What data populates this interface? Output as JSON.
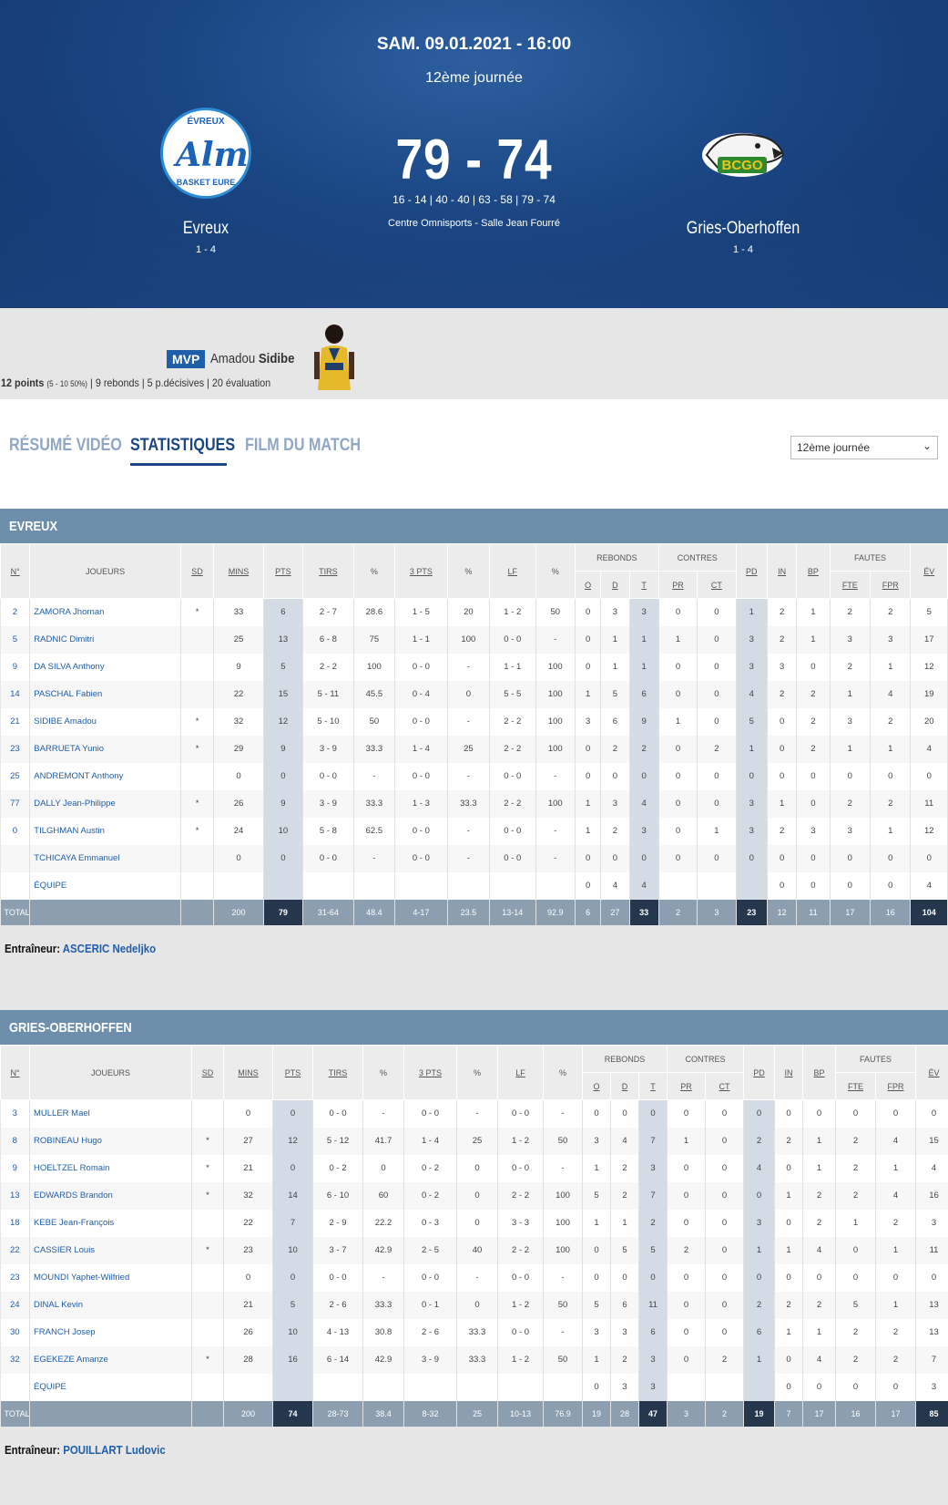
{
  "match": {
    "date": "SAM. 09.01.2021 - 16:00",
    "round": "12ème journée",
    "score": "79 - 74",
    "periods": "16 - 14 | 40 - 40 | 63 - 58 | 79 - 74",
    "venue": "Centre Omnisports - Salle Jean Fourré",
    "home": {
      "name": "Evreux",
      "record": "1 - 4",
      "logo_top": "ÉVREUX",
      "logo_main": "Alm",
      "logo_bottom": "BASKET EURE"
    },
    "away": {
      "name": "Gries-Oberhoffen",
      "record": "1 - 4",
      "logo_text": "BCGO"
    }
  },
  "mvp": {
    "tag": "MVP",
    "first_name": "Amadou",
    "last_name": "Sidibe",
    "points": "12 points",
    "shooting": "(5 - 10 50%)",
    "rest": "| 9 rebonds | 5 p.décisives | 20 évaluation"
  },
  "tabs": [
    "RÉSUMÉ VIDÉO",
    "STATISTIQUES",
    "FILM DU MATCH"
  ],
  "round_select": "12ème journée",
  "headers": {
    "num": "N°",
    "player": "JOUEURS",
    "sd": "SD",
    "mins": "MINS",
    "pts": "PTS",
    "tirs": "TIRS",
    "pct": "%",
    "three": "3 PTS",
    "lf": "LF",
    "rebonds": "REBONDS",
    "o": "O",
    "d": "D",
    "t": "T",
    "contres": "CONTRES",
    "pr": "PR",
    "ct": "CT",
    "pd": "PD",
    "in": "IN",
    "bp": "BP",
    "fautes": "FAUTES",
    "fte": "FTE",
    "fpr": "FPR",
    "ev": "ÉV"
  },
  "teams": [
    {
      "title": "EVREUX",
      "coach_label": "Entraîneur:",
      "coach": "ASCERIC Nedeljko",
      "players": [
        [
          "2",
          "ZAMORA Jhornan",
          "*",
          "33",
          "6",
          "2 - 7",
          "28.6",
          "1 - 5",
          "20",
          "1 - 2",
          "50",
          "0",
          "3",
          "3",
          "0",
          "0",
          "1",
          "2",
          "1",
          "2",
          "2",
          "5"
        ],
        [
          "5",
          "RADNIC Dimitri",
          "",
          "25",
          "13",
          "6 - 8",
          "75",
          "1 - 1",
          "100",
          "0 - 0",
          "-",
          "0",
          "1",
          "1",
          "1",
          "0",
          "3",
          "2",
          "1",
          "3",
          "3",
          "17"
        ],
        [
          "9",
          "DA SILVA Anthony",
          "",
          "9",
          "5",
          "2 - 2",
          "100",
          "0 - 0",
          "-",
          "1 - 1",
          "100",
          "0",
          "1",
          "1",
          "0",
          "0",
          "3",
          "3",
          "0",
          "2",
          "1",
          "12"
        ],
        [
          "14",
          "PASCHAL Fabien",
          "",
          "22",
          "15",
          "5 - 11",
          "45.5",
          "0 - 4",
          "0",
          "5 - 5",
          "100",
          "1",
          "5",
          "6",
          "0",
          "0",
          "4",
          "2",
          "2",
          "1",
          "4",
          "19"
        ],
        [
          "21",
          "SIDIBE Amadou",
          "*",
          "32",
          "12",
          "5 - 10",
          "50",
          "0 - 0",
          "-",
          "2 - 2",
          "100",
          "3",
          "6",
          "9",
          "1",
          "0",
          "5",
          "0",
          "2",
          "3",
          "2",
          "20"
        ],
        [
          "23",
          "BARRUETA Yunio",
          "*",
          "29",
          "9",
          "3 - 9",
          "33.3",
          "1 - 4",
          "25",
          "2 - 2",
          "100",
          "0",
          "2",
          "2",
          "0",
          "2",
          "1",
          "0",
          "2",
          "1",
          "1",
          "4"
        ],
        [
          "25",
          "ANDREMONT Anthony",
          "",
          "0",
          "0",
          "0 - 0",
          "-",
          "0 - 0",
          "-",
          "0 - 0",
          "-",
          "0",
          "0",
          "0",
          "0",
          "0",
          "0",
          "0",
          "0",
          "0",
          "0",
          "0"
        ],
        [
          "77",
          "DALLY Jean-Philippe",
          "*",
          "26",
          "9",
          "3 - 9",
          "33.3",
          "1 - 3",
          "33.3",
          "2 - 2",
          "100",
          "1",
          "3",
          "4",
          "0",
          "0",
          "3",
          "1",
          "0",
          "2",
          "2",
          "11"
        ],
        [
          "0",
          "TILGHMAN Austin",
          "*",
          "24",
          "10",
          "5 - 8",
          "62.5",
          "0 - 0",
          "-",
          "0 - 0",
          "-",
          "1",
          "2",
          "3",
          "0",
          "1",
          "3",
          "2",
          "3",
          "3",
          "1",
          "12"
        ],
        [
          "",
          "TCHICAYA Emmanuel",
          "",
          "0",
          "0",
          "0 - 0",
          "-",
          "0 - 0",
          "-",
          "0 - 0",
          "-",
          "0",
          "0",
          "0",
          "0",
          "0",
          "0",
          "0",
          "0",
          "0",
          "0",
          "0"
        ],
        [
          "",
          "ÉQUIPE",
          "",
          "",
          "",
          "",
          "",
          "",
          "",
          "",
          "",
          "0",
          "4",
          "4",
          "",
          "",
          "",
          "0",
          "0",
          "0",
          "0",
          "4"
        ]
      ],
      "total": [
        "TOTAL",
        "",
        "",
        "200",
        "79",
        "31-64",
        "48.4",
        "4-17",
        "23.5",
        "13-14",
        "92.9",
        "6",
        "27",
        "33",
        "2",
        "3",
        "23",
        "12",
        "11",
        "17",
        "16",
        "104"
      ]
    },
    {
      "title": "GRIES-OBERHOFFEN",
      "coach_label": "Entraîneur:",
      "coach": "POUILLART Ludovic",
      "players": [
        [
          "3",
          "MULLER Mael",
          "",
          "0",
          "0",
          "0 - 0",
          "-",
          "0 - 0",
          "-",
          "0 - 0",
          "-",
          "0",
          "0",
          "0",
          "0",
          "0",
          "0",
          "0",
          "0",
          "0",
          "0",
          "0"
        ],
        [
          "8",
          "ROBINEAU Hugo",
          "*",
          "27",
          "12",
          "5 - 12",
          "41.7",
          "1 - 4",
          "25",
          "1 - 2",
          "50",
          "3",
          "4",
          "7",
          "1",
          "0",
          "2",
          "2",
          "1",
          "2",
          "4",
          "15"
        ],
        [
          "9",
          "HOELTZEL Romain",
          "*",
          "21",
          "0",
          "0 - 2",
          "0",
          "0 - 2",
          "0",
          "0 - 0",
          "-",
          "1",
          "2",
          "3",
          "0",
          "0",
          "4",
          "0",
          "1",
          "2",
          "1",
          "4"
        ],
        [
          "13",
          "EDWARDS Brandon",
          "*",
          "32",
          "14",
          "6 - 10",
          "60",
          "0 - 2",
          "0",
          "2 - 2",
          "100",
          "5",
          "2",
          "7",
          "0",
          "0",
          "0",
          "1",
          "2",
          "2",
          "4",
          "16"
        ],
        [
          "18",
          "KEBE Jean-François",
          "",
          "22",
          "7",
          "2 - 9",
          "22.2",
          "0 - 3",
          "0",
          "3 - 3",
          "100",
          "1",
          "1",
          "2",
          "0",
          "0",
          "3",
          "0",
          "2",
          "1",
          "2",
          "3"
        ],
        [
          "22",
          "CASSIER Louis",
          "*",
          "23",
          "10",
          "3 - 7",
          "42.9",
          "2 - 5",
          "40",
          "2 - 2",
          "100",
          "0",
          "5",
          "5",
          "2",
          "0",
          "1",
          "1",
          "4",
          "0",
          "1",
          "11"
        ],
        [
          "23",
          "MOUNDI Yaphet-Wilfried",
          "",
          "0",
          "0",
          "0 - 0",
          "-",
          "0 - 0",
          "-",
          "0 - 0",
          "-",
          "0",
          "0",
          "0",
          "0",
          "0",
          "0",
          "0",
          "0",
          "0",
          "0",
          "0"
        ],
        [
          "24",
          "DINAL Kevin",
          "",
          "21",
          "5",
          "2 - 6",
          "33.3",
          "0 - 1",
          "0",
          "1 - 2",
          "50",
          "5",
          "6",
          "11",
          "0",
          "0",
          "2",
          "2",
          "2",
          "5",
          "1",
          "13"
        ],
        [
          "30",
          "FRANCH Josep",
          "",
          "26",
          "10",
          "4 - 13",
          "30.8",
          "2 - 6",
          "33.3",
          "0 - 0",
          "-",
          "3",
          "3",
          "6",
          "0",
          "0",
          "6",
          "1",
          "1",
          "2",
          "2",
          "13"
        ],
        [
          "32",
          "EGEKEZE Amanze",
          "*",
          "28",
          "16",
          "6 - 14",
          "42.9",
          "3 - 9",
          "33.3",
          "1 - 2",
          "50",
          "1",
          "2",
          "3",
          "0",
          "2",
          "1",
          "0",
          "4",
          "2",
          "2",
          "7"
        ],
        [
          "",
          "ÉQUIPE",
          "",
          "",
          "",
          "",
          "",
          "",
          "",
          "",
          "",
          "0",
          "3",
          "3",
          "",
          "",
          "",
          "0",
          "0",
          "0",
          "0",
          "3"
        ]
      ],
      "total": [
        "TOTAL",
        "",
        "",
        "200",
        "74",
        "28-73",
        "38.4",
        "8-32",
        "25",
        "10-13",
        "76.9",
        "19",
        "28",
        "47",
        "3",
        "2",
        "19",
        "7",
        "17",
        "16",
        "17",
        "85"
      ]
    }
  ]
}
